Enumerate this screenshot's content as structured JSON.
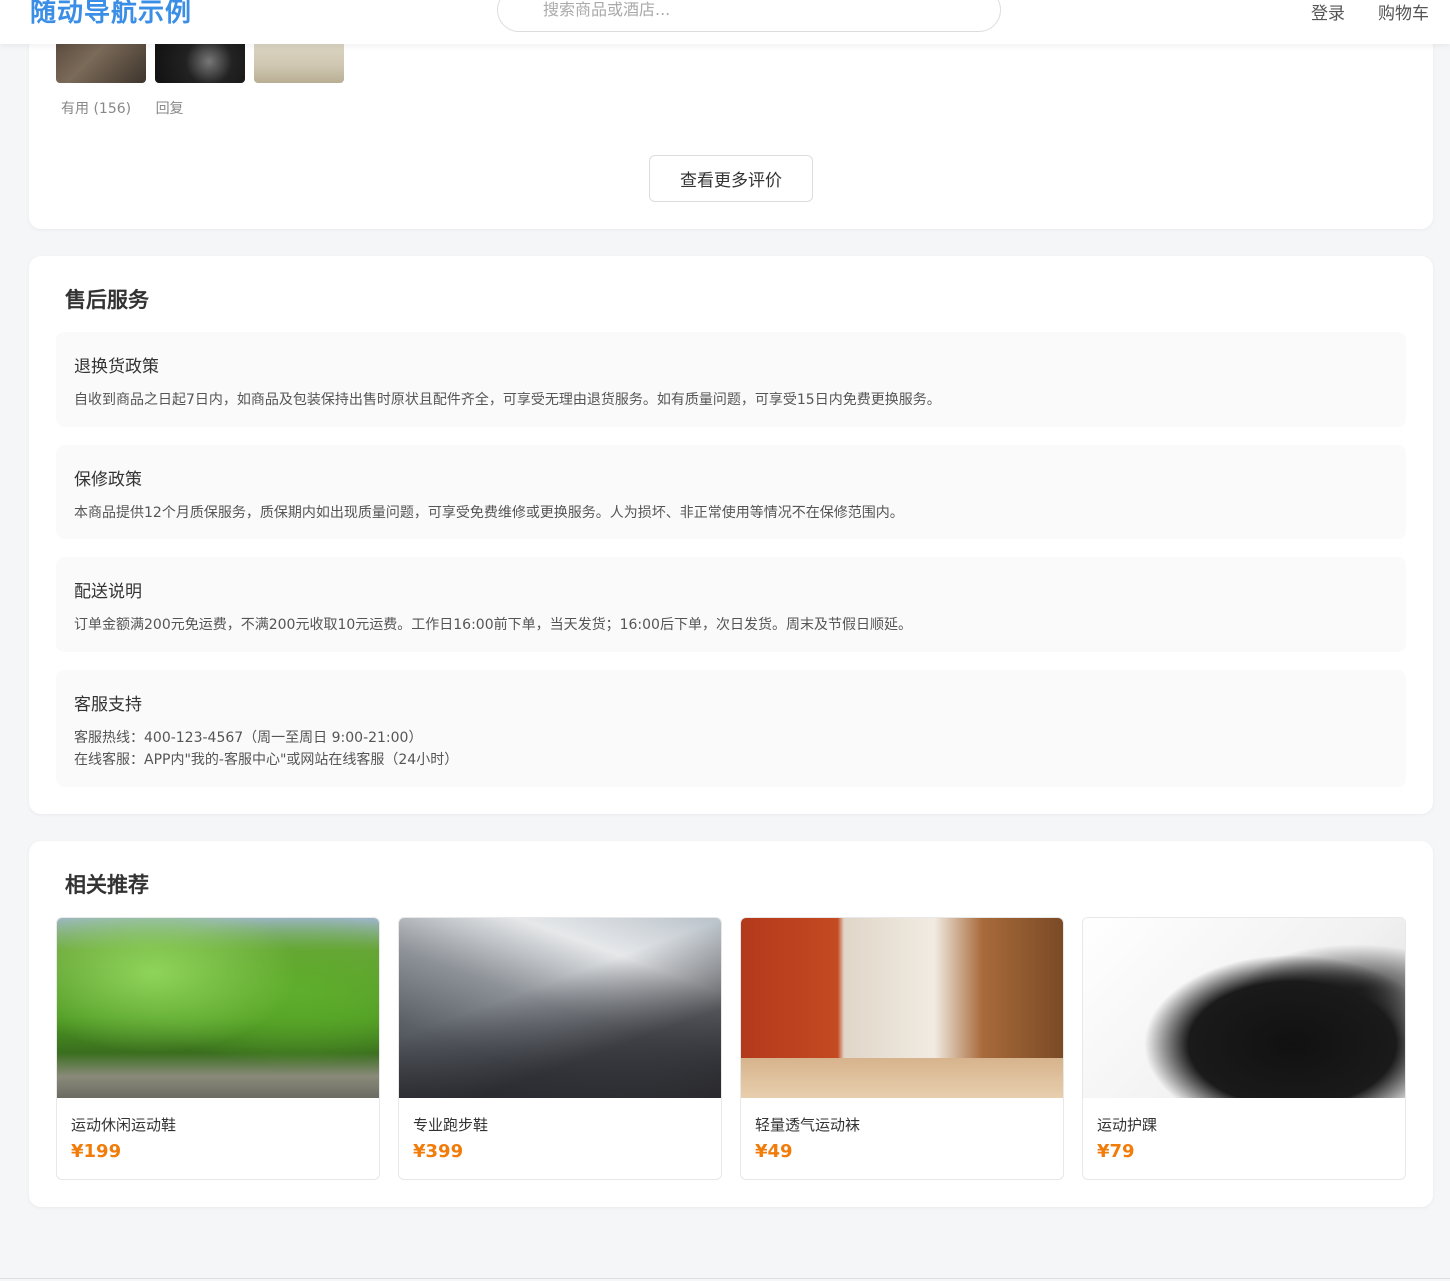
{
  "header": {
    "brand": "随动导航示例",
    "search_placeholder": "搜索商品或酒店...",
    "login_label": "登录",
    "cart_label": "购物车"
  },
  "reviews": {
    "helpful_label": "有用 (156)",
    "reply_label": "回复",
    "more_button_label": "查看更多评价"
  },
  "after_sales": {
    "title": "售后服务",
    "policies": [
      {
        "title": "退换货政策",
        "text": "自收到商品之日起7日内，如商品及包装保持出售时原状且配件齐全，可享受无理由退货服务。如有质量问题，可享受15日内免费更换服务。"
      },
      {
        "title": "保修政策",
        "text": "本商品提供12个月质保服务，质保期内如出现质量问题，可享受免费维修或更换服务。人为损坏、非正常使用等情况不在保修范围内。"
      },
      {
        "title": "配送说明",
        "text": "订单金额满200元免运费，不满200元收取10元运费。工作日16:00前下单，当天发货；16:00后下单，次日发货。周末及节假日顺延。"
      },
      {
        "title": "客服支持",
        "line1": "客服热线：400-123-4567（周一至周日 9:00-21:00）",
        "line2": "在线客服：APP内\"我的-客服中心\"或网站在线客服（24小时）"
      }
    ]
  },
  "recommendations": {
    "title": "相关推荐",
    "products": [
      {
        "name": "运动休闲运动鞋",
        "price": "¥199"
      },
      {
        "name": "专业跑步鞋",
        "price": "¥399"
      },
      {
        "name": "轻量透气运动袜",
        "price": "¥49"
      },
      {
        "name": "运动护踝",
        "price": "¥79"
      }
    ]
  }
}
